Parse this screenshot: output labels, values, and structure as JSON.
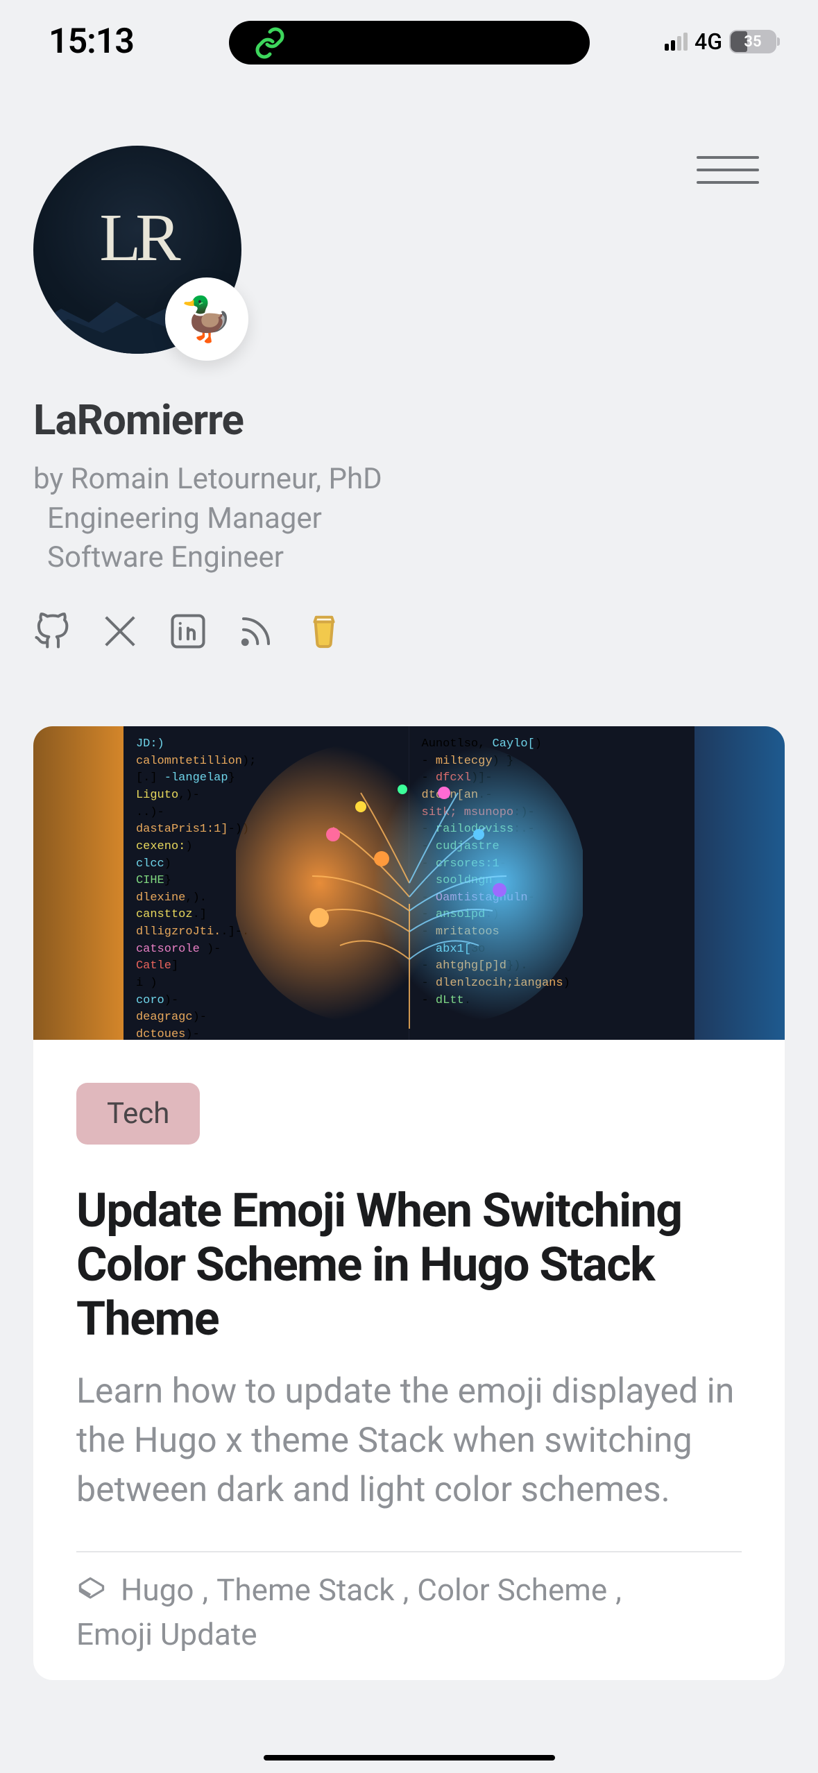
{
  "status": {
    "time": "15:13",
    "network": "4G",
    "battery": "35"
  },
  "site": {
    "title": "LaRomierre",
    "avatar_initials": "LR",
    "badge_emoji": "🦆",
    "byline1": "by Romain Letourneur, PhD",
    "byline2": "Engineering Manager",
    "byline3": "Software Engineer"
  },
  "social": {
    "github": "github-icon",
    "x": "x-icon",
    "linkedin": "linkedin-icon",
    "rss": "rss-icon",
    "support": "coffee-icon"
  },
  "post": {
    "category": "Tech",
    "title": "Update Emoji When Switching Color Scheme in Hugo Stack Theme",
    "excerpt": "Learn how to update the emoji displayed in the Hugo x theme Stack when switching between dark and light color schemes.",
    "tags": [
      "Hugo",
      "Theme Stack",
      "Color Scheme",
      "Emoji Update"
    ],
    "tag_sep": ","
  }
}
